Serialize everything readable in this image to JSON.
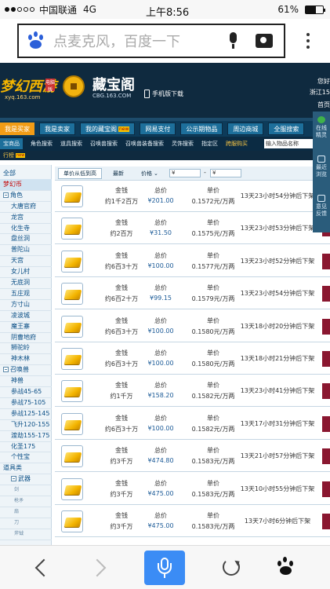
{
  "status_bar": {
    "carrier": "中国联通",
    "network": "4G",
    "time": "上午8:56",
    "battery_percent": "61%",
    "battery_level": 0.61
  },
  "browser": {
    "search_placeholder": "点麦克风，百度一下"
  },
  "site_header": {
    "game_logo_text": "梦幻西游",
    "game_logo_url": "xyq.163.com",
    "badge": "电脑版",
    "title": "藏宝阁",
    "url": "CBG.163.COM",
    "mobile_download": "手机版下载",
    "right_line_1": "您好",
    "right_line_2": "浙江15",
    "right_line_3": "首页"
  },
  "nav": {
    "items": [
      {
        "label": "我是买家",
        "active": true
      },
      {
        "label": "我是卖家",
        "active": false
      },
      {
        "label": "我的藏宝阁",
        "active": false,
        "hot": "new"
      },
      {
        "label": "网易支付",
        "active": false
      },
      {
        "label": "公示期物品",
        "active": false
      },
      {
        "label": "周边商城",
        "active": false
      },
      {
        "label": "全服搜索",
        "active": false
      }
    ]
  },
  "subnav": {
    "items": [
      {
        "label": "宝商品",
        "active": true
      },
      {
        "label": "角色搜索",
        "active": false
      },
      {
        "label": "道具搜索",
        "active": false
      },
      {
        "label": "召唤兽搜索",
        "active": false
      },
      {
        "label": "召唤兽装备搜索",
        "active": false
      },
      {
        "label": "灵饰搜索",
        "active": false
      },
      {
        "label": "指定区",
        "active": false
      },
      {
        "label": "跨服购买",
        "active": false,
        "hot": true
      }
    ],
    "search_placeholder": "输入物品名称"
  },
  "rank_row": {
    "label": "行榜",
    "badge": "new"
  },
  "float_bar": {
    "items": [
      "在线\n精灵",
      "最近\n浏览",
      "意见\n反馈"
    ]
  },
  "sidebar": {
    "rows": [
      {
        "label": "全部",
        "kind": "cat",
        "red": false
      },
      {
        "label": "梦幻币",
        "kind": "cat",
        "red": true
      },
      {
        "label": "角色",
        "kind": "cat",
        "red": false,
        "minus": true
      },
      {
        "label": "大唐官府",
        "kind": "sub"
      },
      {
        "label": "龙宫",
        "kind": "sub"
      },
      {
        "label": "化生寺",
        "kind": "sub"
      },
      {
        "label": "盘丝洞",
        "kind": "sub"
      },
      {
        "label": "普陀山",
        "kind": "sub"
      },
      {
        "label": "天宫",
        "kind": "sub"
      },
      {
        "label": "女儿村",
        "kind": "sub"
      },
      {
        "label": "无底洞",
        "kind": "sub"
      },
      {
        "label": "五庄观",
        "kind": "sub"
      },
      {
        "label": "方寸山",
        "kind": "sub"
      },
      {
        "label": "凌波城",
        "kind": "sub"
      },
      {
        "label": "魔王寨",
        "kind": "sub"
      },
      {
        "label": "阴曹地府",
        "kind": "sub"
      },
      {
        "label": "狮驼岭",
        "kind": "sub"
      },
      {
        "label": "神木林",
        "kind": "sub"
      },
      {
        "label": "召唤兽",
        "kind": "cat",
        "red": false,
        "minus": true
      },
      {
        "label": "神兽",
        "kind": "sub"
      },
      {
        "label": "参战45-65",
        "kind": "sub"
      },
      {
        "label": "参战75-105",
        "kind": "sub"
      },
      {
        "label": "参战125-145",
        "kind": "sub"
      },
      {
        "label": "飞升120-155",
        "kind": "sub"
      },
      {
        "label": "渡劫155-175",
        "kind": "sub"
      },
      {
        "label": "化圣175",
        "kind": "sub"
      },
      {
        "label": "个性宝",
        "kind": "sub"
      },
      {
        "label": "道具类",
        "kind": "cat",
        "red": false
      },
      {
        "label": "武器",
        "kind": "sub",
        "minus": true
      },
      {
        "label": "剑",
        "kind": "subsub"
      },
      {
        "label": "枪矛",
        "kind": "subsub"
      },
      {
        "label": "扇",
        "kind": "subsub"
      },
      {
        "label": "刀",
        "kind": "subsub"
      },
      {
        "label": "斧钺",
        "kind": "subsub"
      }
    ]
  },
  "filter": {
    "tab_active": "单价从低到高",
    "tab_newest": "最新",
    "tab_price": "价格",
    "price_from": "¥",
    "dash": "-",
    "price_to": "¥"
  },
  "listings": [
    {
      "name": "金钱",
      "qty": "约1千2百万",
      "total_label": "总价",
      "total": "¥201.00",
      "unit_label": "单价",
      "unit": "0.1572元/万两",
      "expire": "13天23小时54分钟后下架"
    },
    {
      "name": "金钱",
      "qty": "约2百万",
      "total_label": "总价",
      "total": "¥31.50",
      "unit_label": "单价",
      "unit": "0.1575元/万两",
      "expire": "13天23小时53分钟后下架"
    },
    {
      "name": "金钱",
      "qty": "约6百3十万",
      "total_label": "总价",
      "total": "¥100.00",
      "unit_label": "单价",
      "unit": "0.1577元/万两",
      "expire": "13天23小时52分钟后下架"
    },
    {
      "name": "金钱",
      "qty": "约6百2十万",
      "total_label": "总价",
      "total": "¥99.15",
      "unit_label": "单价",
      "unit": "0.1579元/万两",
      "expire": "13天23小时54分钟后下架"
    },
    {
      "name": "金钱",
      "qty": "约6百3十万",
      "total_label": "总价",
      "total": "¥100.00",
      "unit_label": "单价",
      "unit": "0.1580元/万两",
      "expire": "13天18小时20分钟后下架"
    },
    {
      "name": "金钱",
      "qty": "约6百3十万",
      "total_label": "总价",
      "total": "¥100.00",
      "unit_label": "单价",
      "unit": "0.1580元/万两",
      "expire": "13天18小时21分钟后下架"
    },
    {
      "name": "金钱",
      "qty": "约1千万",
      "total_label": "总价",
      "total": "¥158.20",
      "unit_label": "单价",
      "unit": "0.1582元/万两",
      "expire": "13天23小时41分钟后下架"
    },
    {
      "name": "金钱",
      "qty": "约6百3十万",
      "total_label": "总价",
      "total": "¥100.00",
      "unit_label": "单价",
      "unit": "0.1582元/万两",
      "expire": "13天17小时31分钟后下架"
    },
    {
      "name": "金钱",
      "qty": "约3千万",
      "total_label": "总价",
      "total": "¥474.80",
      "unit_label": "单价",
      "unit": "0.1583元/万两",
      "expire": "13天21小时57分钟后下架"
    },
    {
      "name": "金钱",
      "qty": "约3千万",
      "total_label": "总价",
      "total": "¥475.00",
      "unit_label": "单价",
      "unit": "0.1583元/万两",
      "expire": "13天10小时55分钟后下架"
    },
    {
      "name": "金钱",
      "qty": "约3千万",
      "total_label": "总价",
      "total": "¥475.00",
      "unit_label": "单价",
      "unit": "0.1583元/万两",
      "expire": "13天7小时6分钟后下架"
    }
  ]
}
